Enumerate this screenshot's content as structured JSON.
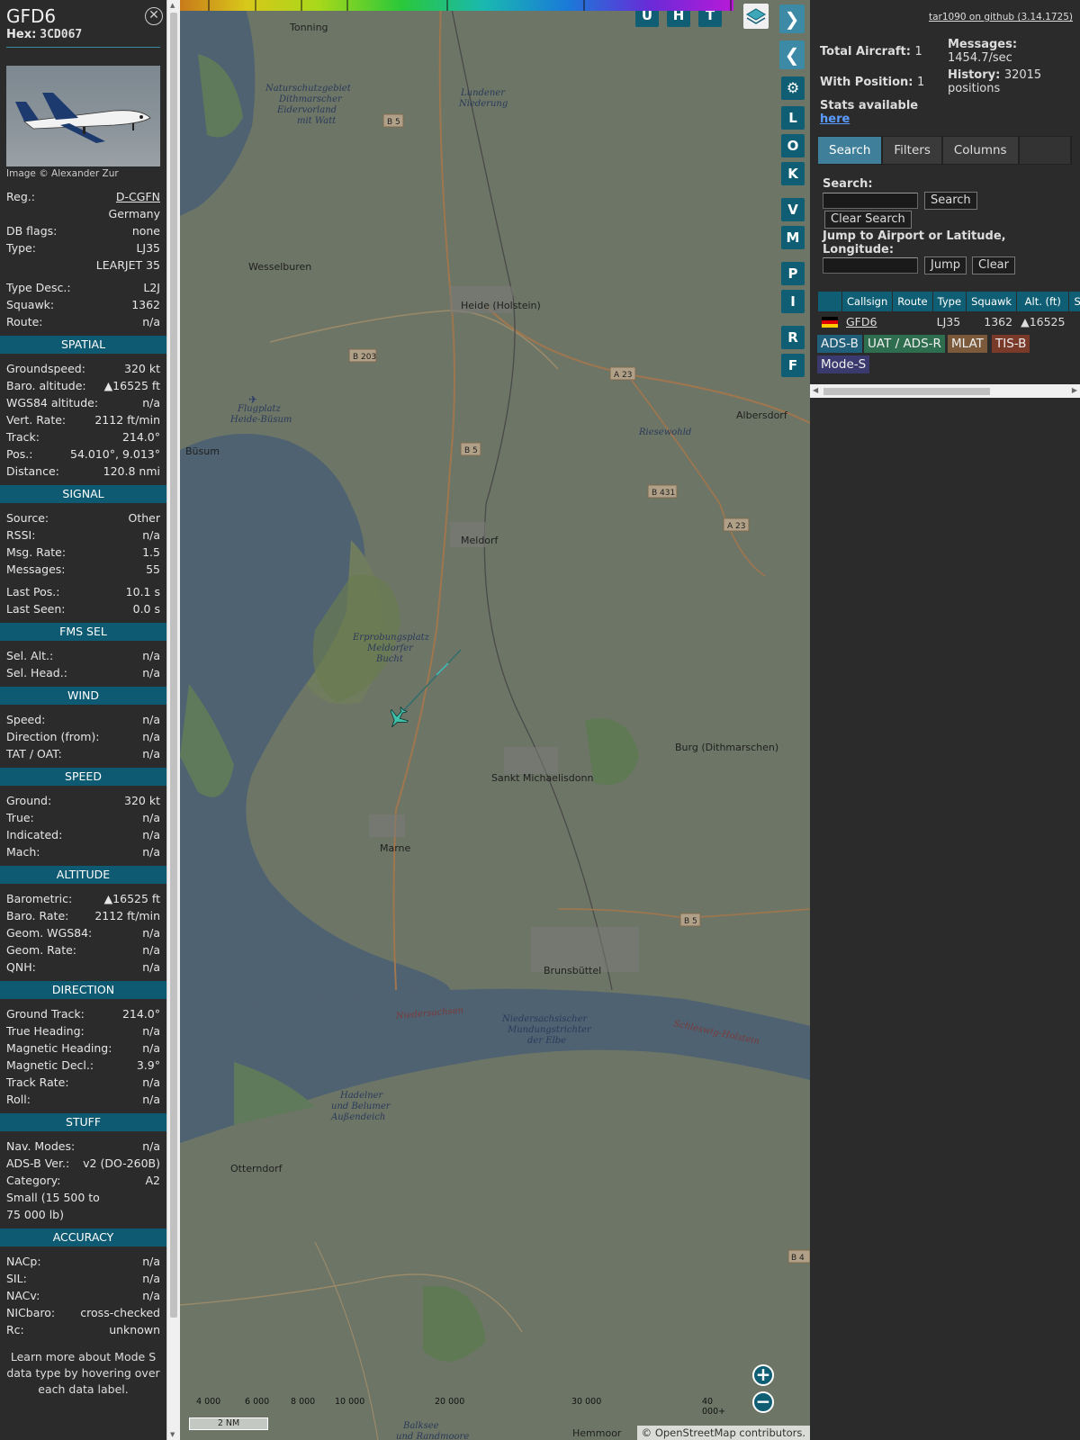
{
  "aircraft": {
    "callsign": "GFD6",
    "hex_label": "Hex:",
    "hex": "3CD067",
    "photo_credit": "Image © Alexander Zur"
  },
  "details": [
    {
      "k": "Reg.:",
      "v": "D-CGFN",
      "link": true
    },
    {
      "k": "",
      "v": "Germany"
    },
    {
      "k": "DB flags:",
      "v": "none"
    },
    {
      "k": "Type:",
      "v": "LJ35"
    },
    {
      "k": "",
      "v": "LEARJET 35"
    },
    {
      "gap": true
    },
    {
      "k": "Type Desc.:",
      "v": "L2J"
    },
    {
      "k": "Squawk:",
      "v": "1362"
    },
    {
      "k": "Route:",
      "v": "n/a"
    }
  ],
  "sections": [
    {
      "title": "SPATIAL",
      "rows": [
        {
          "k": "Groundspeed:",
          "v": "320 kt"
        },
        {
          "k": "Baro. altitude:",
          "v": "▲16525 ft"
        },
        {
          "k": "WGS84 altitude:",
          "v": "n/a"
        },
        {
          "k": "Vert. Rate:",
          "v": "2112 ft/min"
        },
        {
          "k": "Track:",
          "v": "214.0°"
        },
        {
          "k": "Pos.:",
          "v": "54.010°, 9.013°"
        },
        {
          "k": "Distance:",
          "v": "120.8 nmi"
        }
      ]
    },
    {
      "title": "SIGNAL",
      "rows": [
        {
          "k": "Source:",
          "v": "Other"
        },
        {
          "k": "RSSI:",
          "v": "n/a"
        },
        {
          "k": "Msg. Rate:",
          "v": "1.5"
        },
        {
          "k": "Messages:",
          "v": "55"
        },
        {
          "gap": true
        },
        {
          "k": "Last Pos.:",
          "v": "10.1 s"
        },
        {
          "k": "Last Seen:",
          "v": "0.0 s"
        }
      ]
    },
    {
      "title": "FMS SEL",
      "rows": [
        {
          "k": "Sel. Alt.:",
          "v": "n/a"
        },
        {
          "k": "Sel. Head.:",
          "v": "n/a"
        }
      ]
    },
    {
      "title": "WIND",
      "rows": [
        {
          "k": "Speed:",
          "v": "n/a"
        },
        {
          "k": "Direction (from):",
          "v": "n/a"
        },
        {
          "k": "TAT / OAT:",
          "v": "n/a"
        }
      ]
    },
    {
      "title": "SPEED",
      "rows": [
        {
          "k": "Ground:",
          "v": "320 kt"
        },
        {
          "k": "True:",
          "v": "n/a"
        },
        {
          "k": "Indicated:",
          "v": "n/a"
        },
        {
          "k": "Mach:",
          "v": "n/a"
        }
      ]
    },
    {
      "title": "ALTITUDE",
      "rows": [
        {
          "k": "Barometric:",
          "v": "▲16525 ft"
        },
        {
          "k": "Baro. Rate:",
          "v": "2112 ft/min"
        },
        {
          "k": "Geom. WGS84:",
          "v": "n/a"
        },
        {
          "k": "Geom. Rate:",
          "v": "n/a"
        },
        {
          "k": "QNH:",
          "v": "n/a"
        }
      ]
    },
    {
      "title": "DIRECTION",
      "rows": [
        {
          "k": "Ground Track:",
          "v": "214.0°"
        },
        {
          "k": "True Heading:",
          "v": "n/a"
        },
        {
          "k": "Magnetic Heading:",
          "v": "n/a"
        },
        {
          "k": "Magnetic Decl.:",
          "v": "3.9°"
        },
        {
          "k": "Track Rate:",
          "v": "n/a"
        },
        {
          "k": "Roll:",
          "v": "n/a"
        }
      ]
    },
    {
      "title": "STUFF",
      "rows": [
        {
          "k": "Nav. Modes:",
          "v": "n/a"
        },
        {
          "k": "ADS-B Ver.:",
          "v": "v2 (DO-260B)"
        },
        {
          "k": "Category:",
          "v": "A2"
        },
        {
          "k": "Small (15 500 to",
          "v": ""
        },
        {
          "k": "75 000 lb)",
          "v": ""
        }
      ]
    },
    {
      "title": "ACCURACY",
      "rows": [
        {
          "k": "NACp:",
          "v": "n/a"
        },
        {
          "k": "SIL:",
          "v": "n/a"
        },
        {
          "k": "NACv:",
          "v": "n/a"
        },
        {
          "k": "NICbaro:",
          "v": "cross-checked"
        },
        {
          "k": "Rc:",
          "v": "unknown"
        }
      ]
    }
  ],
  "footer": "Learn more about Mode S data type by hovering over each data label.",
  "map": {
    "top_buttons": [
      "U",
      "H",
      "T"
    ],
    "side_buttons": [
      "L",
      "O",
      "K",
      "V",
      "M",
      "P",
      "I",
      "R",
      "F"
    ],
    "places": [
      "Tonning",
      "Wesselburen",
      "Heide (Holstein)",
      "Albersdorf",
      "Büsum",
      "Meldorf",
      "Burg (Dithmarschen)",
      "Sankt Michaelisdonn",
      "Marne",
      "Brunsbüttel",
      "Otterndorf",
      "Hemmoor",
      "Riesewohld"
    ],
    "nature_labels": [
      "Naturschutzgebiet",
      "Dithmarscher",
      "Eidervorland",
      "mit Watt",
      "Lundener",
      "Niederung",
      "Flugplatz",
      "Heide-Büsum",
      "Erprobungsplatz",
      "Meldorfer",
      "Bucht",
      "Niedersachsischer",
      "Mundungstrichter",
      "der Elbe",
      "Hadelner",
      "und Belumer",
      "Außendeich",
      "Balksee",
      "und Randmoore",
      "Niedersachsen",
      "Schleswig-Holstein"
    ],
    "road_labels": [
      "B 5",
      "B 203",
      "A 23",
      "B 431",
      "B 5",
      "B 5",
      "A 23",
      "B 4"
    ],
    "legend_ticks": [
      "4 000",
      "6 000",
      "8 000",
      "10 000",
      "20 000",
      "30 000",
      "40 000+"
    ],
    "scale": "2 NM",
    "attribution": "© OpenStreetMap contributors."
  },
  "right": {
    "github": "tar1090 on github (3.14.1725)",
    "total_label": "Total Aircraft:",
    "total": "1",
    "withpos_label": "With Position:",
    "withpos": "1",
    "stats_label": "Stats available",
    "stats_link": "here",
    "messages_label": "Messages:",
    "messages": "1454.7/sec",
    "history_label": "History:",
    "history": "32015 positions",
    "tabs": [
      "Search",
      "Filters",
      "Columns"
    ],
    "search_label": "Search:",
    "search_btn": "Search",
    "clear_search": "Clear Search",
    "jump_label": "Jump to Airport or Latitude, Longitude:",
    "jump_btn": "Jump",
    "clear_btn": "Clear",
    "columns": [
      "Callsign",
      "Route",
      "Type",
      "Squawk",
      "Alt. (ft)",
      "Spd"
    ],
    "rows": [
      {
        "callsign": "GFD6",
        "route": "",
        "type": "LJ35",
        "squawk": "1362",
        "alt": "▲16525"
      }
    ],
    "chips": [
      {
        "label": "ADS-B",
        "color": "#1f5f7a"
      },
      {
        "label": "UAT / ADS-R",
        "color": "#2e6e4e"
      },
      {
        "label": "MLAT",
        "color": "#7a5a3a"
      },
      {
        "label": "TIS-B",
        "color": "#7a3a2a"
      },
      {
        "label": "Mode-S",
        "color": "#3a3a6e"
      }
    ]
  }
}
